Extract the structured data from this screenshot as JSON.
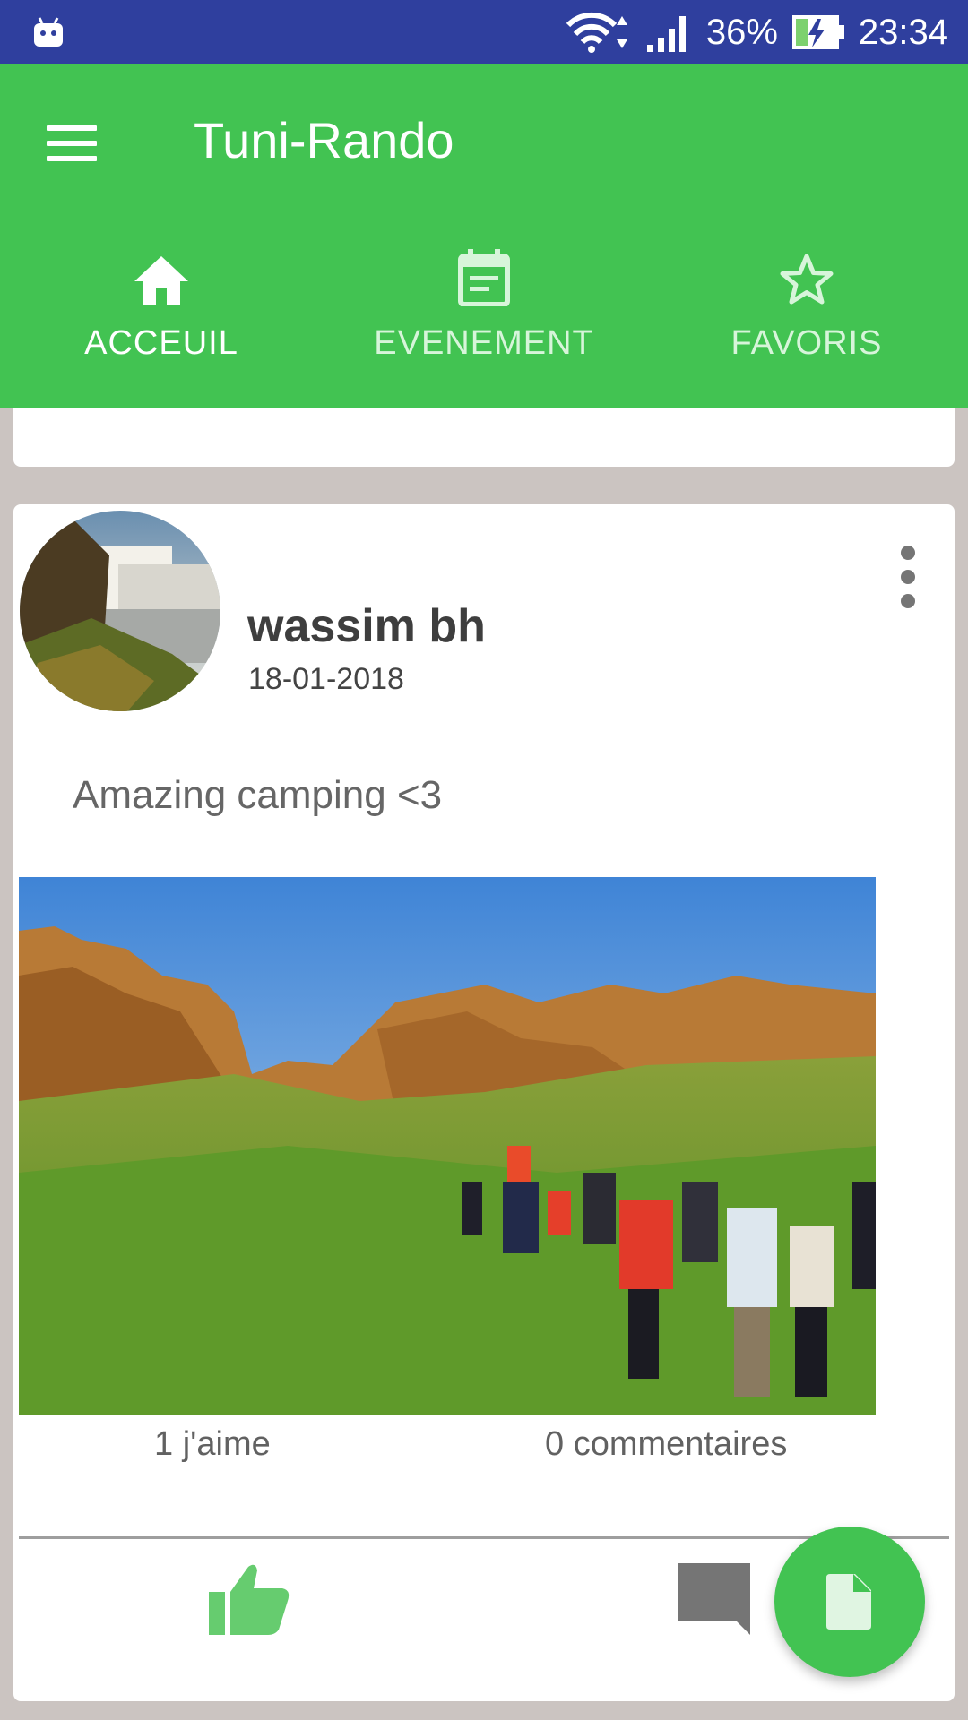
{
  "status_bar": {
    "battery": "36%",
    "time": "23:34",
    "icons": [
      "android-icon",
      "wifi-icon",
      "signal-icon",
      "battery-charging-icon"
    ]
  },
  "app_bar": {
    "title": "Tuni-Rando",
    "tabs": [
      {
        "label": "ACCEUIL",
        "icon": "home-icon",
        "active": true
      },
      {
        "label": "EVENEMENT",
        "icon": "calendar-icon",
        "active": false
      },
      {
        "label": "FAVORIS",
        "icon": "star-icon",
        "active": false
      }
    ]
  },
  "post": {
    "author": "wassim bh",
    "date": "18-01-2018",
    "caption": "Amazing camping <3",
    "likes": "1 j'aime",
    "comments": "0 commentaires"
  },
  "colors": {
    "status_bar": "#2f3f9e",
    "primary": "#42c352",
    "like_icon": "#66cc6f",
    "comment_icon": "#757575"
  }
}
